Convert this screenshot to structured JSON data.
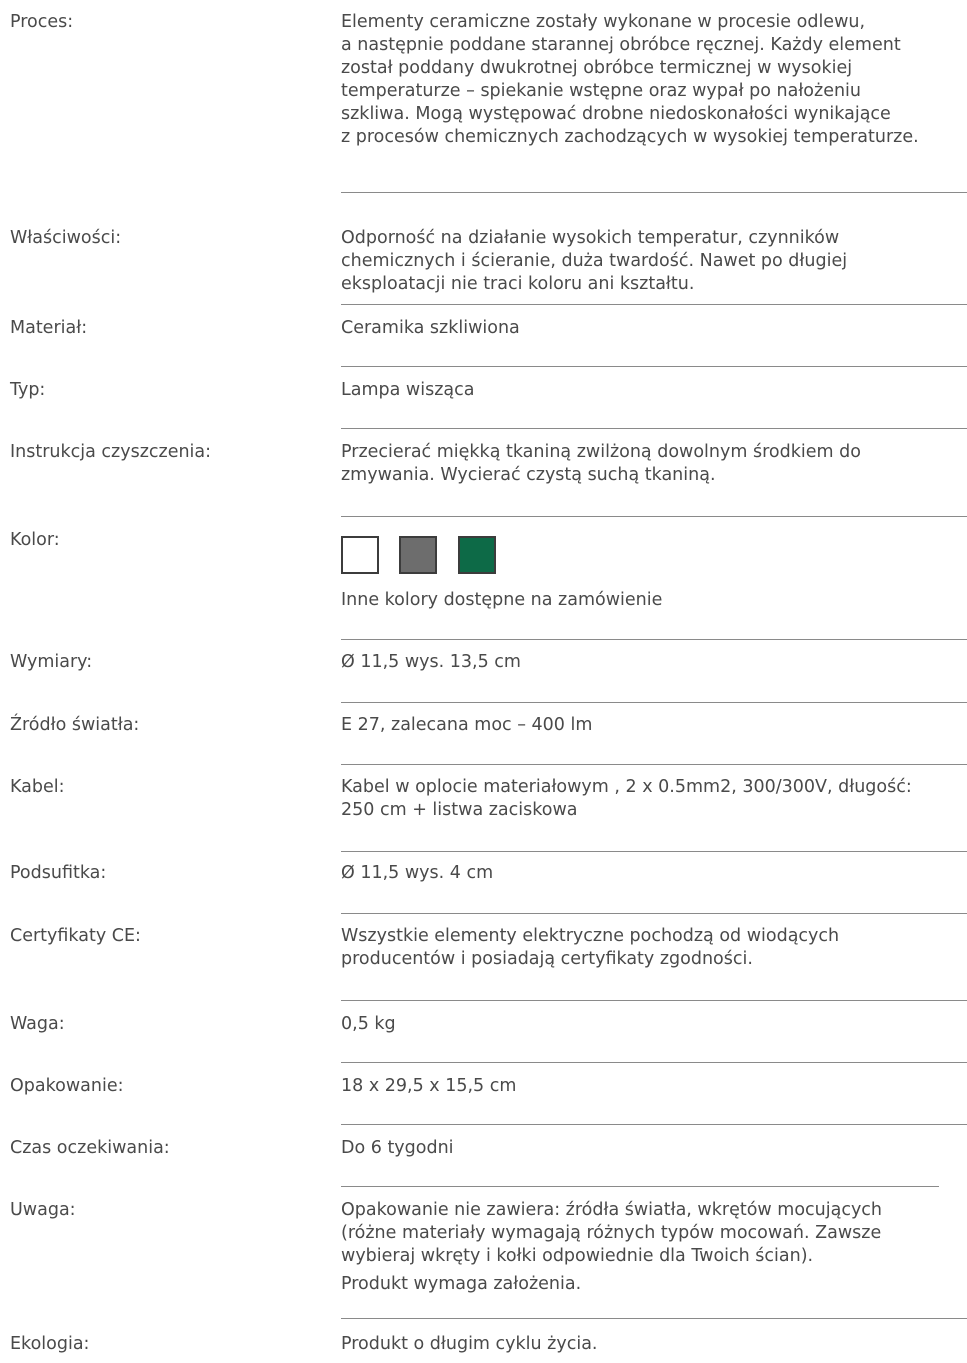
{
  "spec": {
    "proces": {
      "label": "Proces:",
      "lines": [
        "Elementy ceramiczne zostały wykonane w procesie odlewu,",
        "a następnie poddane starannej obróbce ręcznej. Każdy element",
        "został poddany dwukrotnej obróbce termicznej w wysokiej",
        "temperaturze – spiekanie wstępne oraz wypał po nałożeniu",
        "szkliwa. Mogą występować  drobne niedoskonałości wynikające",
        "z procesów chemicznych zachodzących w wysokiej temperaturze."
      ]
    },
    "wlasciwosci": {
      "label": "Właściwości:",
      "lines": [
        "Odporność na działanie wysokich temperatur, czynników",
        "chemicznych i ścieranie, duża twardość. Nawet po długiej",
        "eksploatacji nie traci koloru ani kształtu."
      ]
    },
    "material": {
      "label": "Materiał:",
      "value": "Ceramika szkliwiona"
    },
    "typ": {
      "label": "Typ:",
      "value": "Lampa wisząca"
    },
    "instrukcja": {
      "label": "Instrukcja czyszczenia:",
      "lines": [
        "Przecierać miękką tkaniną zwilżoną dowolnym  środkiem do",
        "zmywania. Wycierać czystą suchą tkaniną."
      ]
    },
    "kolor": {
      "label": "Kolor:",
      "swatch_colors": [
        "#ffffff",
        "#6d6d6d",
        "#0d6a47"
      ],
      "note": "Inne kolory dostępne na zamówienie"
    },
    "wymiary": {
      "label": "Wymiary:",
      "value": "Ø 11,5  wys. 13,5 cm"
    },
    "zrodlo": {
      "label": "Źródło światła:",
      "value": "E 27, zalecana moc – 400 lm"
    },
    "kabel": {
      "label": "Kabel:",
      "lines": [
        "Kabel w oplocie materiałowym , 2 x 0.5mm2, 300/300V, długość:",
        "250 cm + listwa zaciskowa"
      ]
    },
    "podsufitka": {
      "label": "Podsufitka:",
      "value": "Ø 11,5  wys. 4 cm"
    },
    "certyfikaty": {
      "label": "Certyfikaty CE:",
      "lines": [
        "Wszystkie elementy elektryczne  pochodzą od wiodących",
        "producentów i posiadają certyfikaty zgodności."
      ]
    },
    "waga": {
      "label": "Waga:",
      "value": "0,5 kg"
    },
    "opakowanie": {
      "label": "Opakowanie:",
      "value": "18 x 29,5 x 15,5 cm"
    },
    "czas": {
      "label": "Czas oczekiwania:",
      "value": "Do 6 tygodni"
    },
    "uwaga": {
      "label": "Uwaga:",
      "lines": [
        "Opakowanie nie zawiera: źródła światła, wkrętów mocujących",
        "(różne materiały wymagają różnych typów mocowań. Zawsze",
        "wybieraj wkręty i kołki odpowiednie dla Twoich ścian)."
      ],
      "extra": "Produkt wymaga założenia."
    },
    "ekologia": {
      "label": "Ekologia:",
      "value": "Produkt o długim cyklu życia."
    }
  }
}
